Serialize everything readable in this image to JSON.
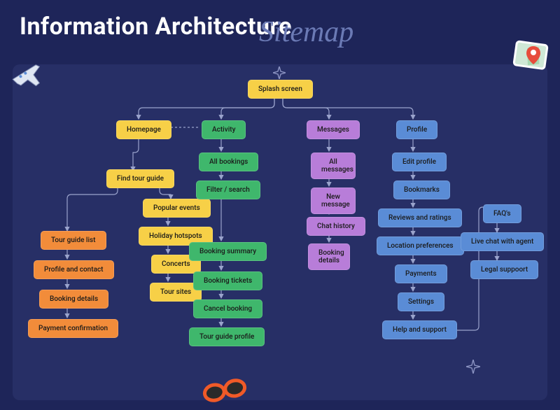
{
  "title": "Information Architecture",
  "subtitle_cursive": "Sitemap",
  "root": {
    "label": "Splash screen"
  },
  "homepage": {
    "label": "Homepage",
    "find_tour_guide": "Find tour guide",
    "items": [
      "Popular events",
      "Holiday hotspots",
      "Concerts",
      "Tour sites"
    ],
    "tour_guide_flow": [
      "Tour guide list",
      "Profile and contact",
      "Booking details",
      "Payment confirmation"
    ]
  },
  "activity": {
    "label": "Activity",
    "items": [
      "All bookings",
      "Filter / search",
      "Booking summary",
      "Booking tickets",
      "Cancel booking",
      "Tour guide profile"
    ]
  },
  "messages": {
    "label": "Messages",
    "items": [
      "All messages",
      "New message",
      "Chat history",
      "Booking details"
    ]
  },
  "profile": {
    "label": "Profile",
    "items": [
      "Edit profile",
      "Bookmarks",
      "Reviews and ratings",
      "Location preferences",
      "Payments",
      "Settings",
      "Help and support"
    ],
    "help": [
      "FAQ's",
      "Live chat with agent",
      "Legal suppoort"
    ]
  },
  "colors": {
    "yellow": "#f7d047",
    "green": "#3fb76c",
    "purple": "#b87dd9",
    "blue": "#5a8cd6",
    "orange": "#f28c3a",
    "bg": "#1e2559",
    "board": "#272f66"
  }
}
